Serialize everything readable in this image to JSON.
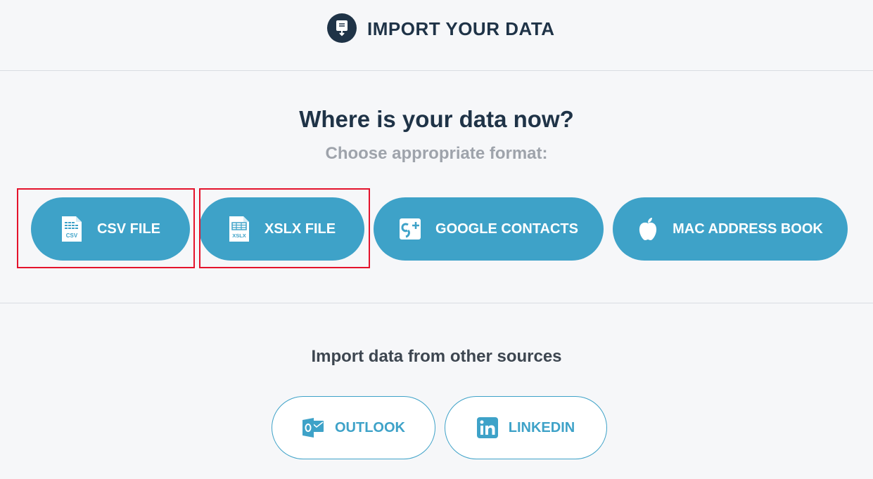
{
  "header": {
    "title": "IMPORT YOUR DATA",
    "icon": "import-document-icon"
  },
  "main": {
    "question": "Where is your data now?",
    "subtitle": "Choose appropriate format:",
    "formats": [
      {
        "label": "CSV FILE",
        "icon": "csv-file-icon",
        "icon_text": "CSV",
        "highlighted": true
      },
      {
        "label": "XSLX FILE",
        "icon": "xlsx-file-icon",
        "icon_text": "XSLX",
        "highlighted": true
      },
      {
        "label": "GOOGLE CONTACTS",
        "icon": "google-plus-icon",
        "highlighted": false
      },
      {
        "label": "MAC ADDRESS BOOK",
        "icon": "apple-icon",
        "highlighted": false
      }
    ]
  },
  "other": {
    "title": "Import data from other sources",
    "sources": [
      {
        "label": "OUTLOOK",
        "icon": "outlook-icon"
      },
      {
        "label": "LINKEDIN",
        "icon": "linkedin-icon"
      }
    ]
  },
  "colors": {
    "accent": "#3ea2c8",
    "dark": "#1f3347",
    "muted": "#9ea3ab",
    "highlight": "#e4132c",
    "background": "#f6f7f9"
  }
}
